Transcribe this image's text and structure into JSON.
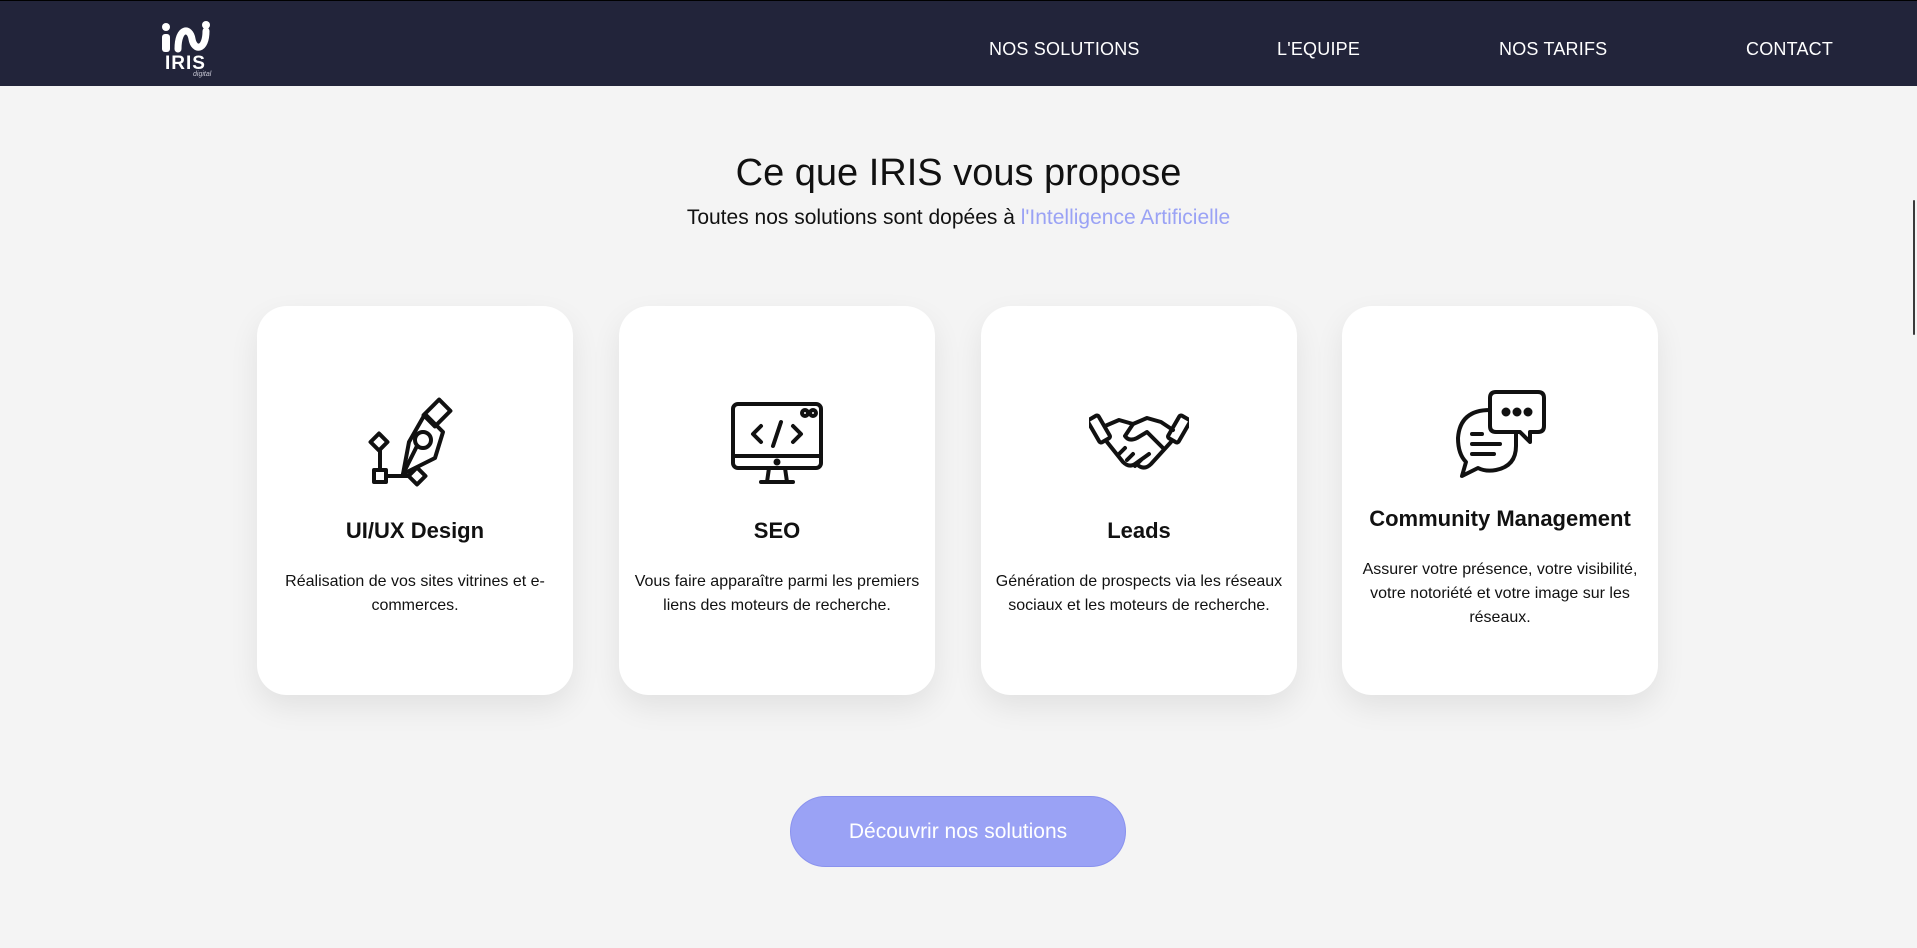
{
  "brand": {
    "name": "IRIS",
    "tagline": "digital"
  },
  "nav": {
    "items": [
      {
        "label": "NOS SOLUTIONS"
      },
      {
        "label": "L'EQUIPE"
      },
      {
        "label": "NOS TARIFS"
      },
      {
        "label": "CONTACT"
      }
    ]
  },
  "section": {
    "title": "Ce que IRIS vous propose",
    "subtitle_prefix": "Toutes nos solutions sont dopées à ",
    "subtitle_highlight": "l'Intelligence Artificielle"
  },
  "cards": [
    {
      "icon": "pen-tool-icon",
      "title": "UI/UX Design",
      "description": "Réalisation de vos sites vitrines et e-commerces."
    },
    {
      "icon": "monitor-code-icon",
      "title": "SEO",
      "description": "Vous faire apparaître parmi les premiers liens des moteurs de recherche."
    },
    {
      "icon": "handshake-icon",
      "title": "Leads",
      "description": "Génération de prospects via les réseaux sociaux et les moteurs de recherche."
    },
    {
      "icon": "chat-bubbles-icon",
      "title": "Community Management",
      "description": "Assurer votre présence, votre visibilité, votre notoriété et votre image sur les réseaux."
    }
  ],
  "cta": {
    "label": "Découvrir nos solutions"
  },
  "colors": {
    "navbar": "#22243a",
    "accent": "#9aa2f5",
    "background": "#f4f4f4"
  }
}
